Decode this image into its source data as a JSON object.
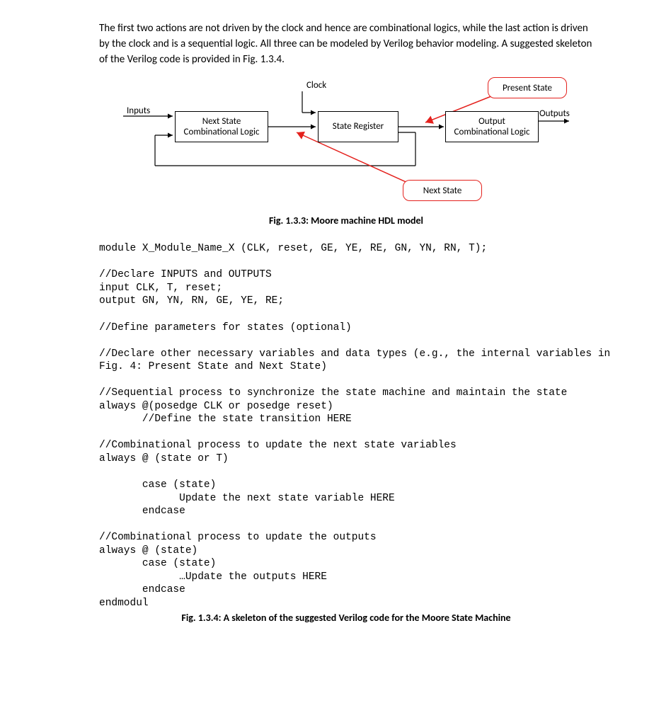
{
  "para1": "The first two actions are not driven by the clock and hence are combinational logics, while the last action is driven by the clock and is a sequential logic. All three can be modeled by Verilog behavior modeling.  A suggested skeleton of the Verilog code is provided in Fig. 1.3.4.",
  "diagram": {
    "clock_label": "Clock",
    "inputs_label": "Inputs",
    "outputs_label": "Outputs",
    "box_next_state_l1": "Next State",
    "box_next_state_l2": "Combinational Logic",
    "box_state_reg": "State Register",
    "box_output_l1": "Output",
    "box_output_l2": "Combinational Logic",
    "red_present_state": "Present State",
    "red_next_state": "Next State"
  },
  "caption1": "Fig. 1.3.3: Moore machine HDL model",
  "code": "module X_Module_Name_X (CLK, reset, GE, YE, RE, GN, YN, RN, T);\n\n//Declare INPUTS and OUTPUTS\ninput CLK, T, reset;\noutput GN, YN, RN, GE, YE, RE;\n\n//Define parameters for states (optional)\n\n//Declare other necessary variables and data types (e.g., the internal variables in\nFig. 4: Present State and Next State)\n\n//Sequential process to synchronize the state machine and maintain the state\nalways @(posedge CLK or posedge reset)\n       //Define the state transition HERE\n\n//Combinational process to update the next state variables\nalways @ (state or T)\n\n       case (state)\n             Update the next state variable HERE\n       endcase\n\n//Combinational process to update the outputs\nalways @ (state)\n       case (state)\n             …Update the outputs HERE\n       endcase\nendmodul",
  "caption2": "Fig. 1.3.4: A skeleton of the suggested Verilog code for the Moore State Machine"
}
